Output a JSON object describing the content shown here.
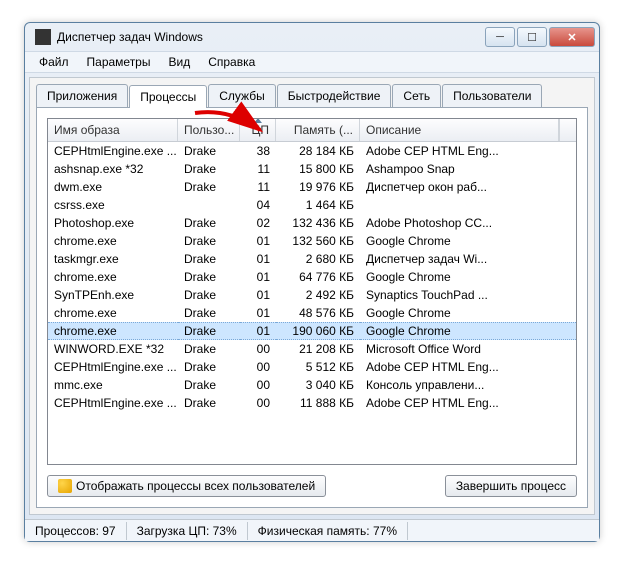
{
  "window_title": "Диспетчер задач Windows",
  "menu": [
    "Файл",
    "Параметры",
    "Вид",
    "Справка"
  ],
  "tabs": [
    "Приложения",
    "Процессы",
    "Службы",
    "Быстродействие",
    "Сеть",
    "Пользователи"
  ],
  "active_tab_index": 1,
  "columns": [
    "Имя образа",
    "Пользо...",
    "ЦП",
    "Память (...",
    "Описание"
  ],
  "sort_column_index": 2,
  "rows": [
    {
      "name": "CEPHtmlEngine.exe ...",
      "user": "Drake",
      "cpu": "38",
      "mem": "28 184 КБ",
      "desc": "Adobe CEP HTML Eng...",
      "selected": false
    },
    {
      "name": "ashsnap.exe *32",
      "user": "Drake",
      "cpu": "11",
      "mem": "15 800 КБ",
      "desc": "Ashampoo Snap",
      "selected": false
    },
    {
      "name": "dwm.exe",
      "user": "Drake",
      "cpu": "11",
      "mem": "19 976 КБ",
      "desc": "Диспетчер окон раб...",
      "selected": false
    },
    {
      "name": "csrss.exe",
      "user": "",
      "cpu": "04",
      "mem": "1 464 КБ",
      "desc": "",
      "selected": false
    },
    {
      "name": "Photoshop.exe",
      "user": "Drake",
      "cpu": "02",
      "mem": "132 436 КБ",
      "desc": "Adobe Photoshop CC...",
      "selected": false
    },
    {
      "name": "chrome.exe",
      "user": "Drake",
      "cpu": "01",
      "mem": "132 560 КБ",
      "desc": "Google Chrome",
      "selected": false
    },
    {
      "name": "taskmgr.exe",
      "user": "Drake",
      "cpu": "01",
      "mem": "2 680 КБ",
      "desc": "Диспетчер задач Wi...",
      "selected": false
    },
    {
      "name": "chrome.exe",
      "user": "Drake",
      "cpu": "01",
      "mem": "64 776 КБ",
      "desc": "Google Chrome",
      "selected": false
    },
    {
      "name": "SynTPEnh.exe",
      "user": "Drake",
      "cpu": "01",
      "mem": "2 492 КБ",
      "desc": "Synaptics TouchPad ...",
      "selected": false
    },
    {
      "name": "chrome.exe",
      "user": "Drake",
      "cpu": "01",
      "mem": "48 576 КБ",
      "desc": "Google Chrome",
      "selected": false
    },
    {
      "name": "chrome.exe",
      "user": "Drake",
      "cpu": "01",
      "mem": "190 060 КБ",
      "desc": "Google Chrome",
      "selected": true
    },
    {
      "name": "WINWORD.EXE *32",
      "user": "Drake",
      "cpu": "00",
      "mem": "21 208 КБ",
      "desc": "Microsoft Office Word",
      "selected": false
    },
    {
      "name": "CEPHtmlEngine.exe ...",
      "user": "Drake",
      "cpu": "00",
      "mem": "5 512 КБ",
      "desc": "Adobe CEP HTML Eng...",
      "selected": false
    },
    {
      "name": "mmc.exe",
      "user": "Drake",
      "cpu": "00",
      "mem": "3 040 КБ",
      "desc": "Консоль управлени...",
      "selected": false
    },
    {
      "name": "CEPHtmlEngine.exe ...",
      "user": "Drake",
      "cpu": "00",
      "mem": "11 888 КБ",
      "desc": "Adobe CEP HTML Eng...",
      "selected": false
    }
  ],
  "show_all_btn": "Отображать процессы всех пользователей",
  "end_proc_btn": "Завершить процесс",
  "status": {
    "processes_label": "Процессов: 97",
    "cpu_label": "Загрузка ЦП: 73%",
    "mem_label": "Физическая память: 77%"
  }
}
